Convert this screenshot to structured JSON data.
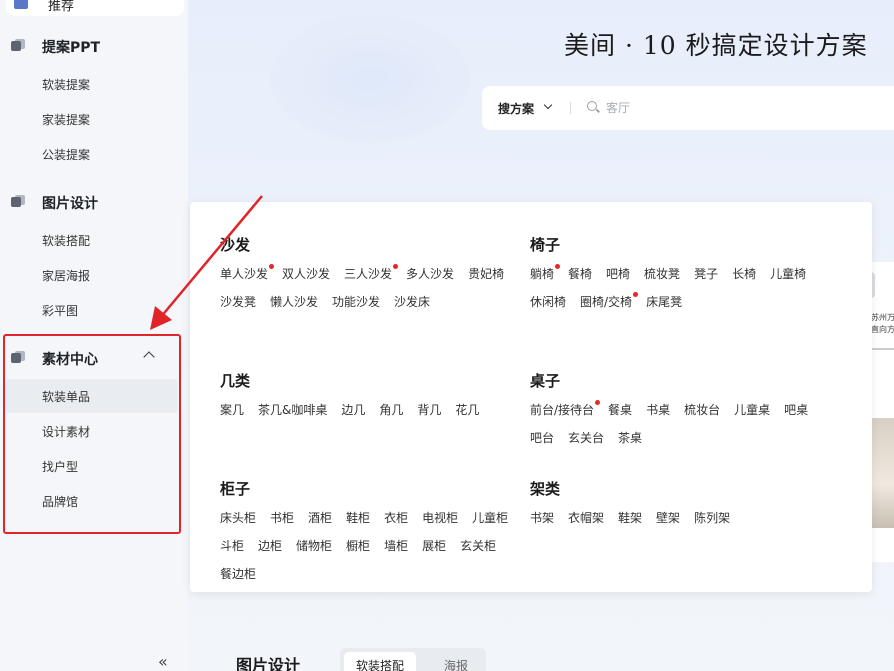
{
  "sidebar": {
    "top_item": "推荐",
    "groups": [
      {
        "label": "提案PPT",
        "items": [
          "软装提案",
          "家装提案",
          "公装提案"
        ]
      },
      {
        "label": "图片设计",
        "items": [
          "软装搭配",
          "家居海报",
          "彩平图"
        ]
      },
      {
        "label": "素材中心",
        "items": [
          "软装单品",
          "设计素材",
          "找户型",
          "品牌馆"
        ]
      }
    ],
    "collapse_glyph": "«"
  },
  "hero": {
    "title": "美间 · 10 秒搞定设计方案"
  },
  "search": {
    "scope_label": "搜方案",
    "placeholder": "客厅"
  },
  "side_card": {
    "line1": "苏州万",
    "line2": "直向方"
  },
  "panel": {
    "categories": [
      {
        "title": "沙发",
        "items": [
          {
            "label": "单人沙发",
            "hot": true
          },
          {
            "label": "双人沙发",
            "hot": false
          },
          {
            "label": "三人沙发",
            "hot": true
          },
          {
            "label": "多人沙发",
            "hot": false
          },
          {
            "label": "贵妃椅",
            "hot": false
          },
          {
            "label": "沙发凳",
            "hot": false
          },
          {
            "label": "懒人沙发",
            "hot": false
          },
          {
            "label": "功能沙发",
            "hot": false
          },
          {
            "label": "沙发床",
            "hot": false
          }
        ]
      },
      {
        "title": "椅子",
        "items": [
          {
            "label": "躺椅",
            "hot": true
          },
          {
            "label": "餐椅",
            "hot": false
          },
          {
            "label": "吧椅",
            "hot": false
          },
          {
            "label": "梳妆凳",
            "hot": false
          },
          {
            "label": "凳子",
            "hot": false
          },
          {
            "label": "长椅",
            "hot": false
          },
          {
            "label": "儿童椅",
            "hot": false
          },
          {
            "label": "休闲椅",
            "hot": false
          },
          {
            "label": "圈椅/交椅",
            "hot": true
          },
          {
            "label": "床尾凳",
            "hot": false
          }
        ]
      },
      {
        "title": "几类",
        "items": [
          {
            "label": "案几",
            "hot": false
          },
          {
            "label": "茶几&咖啡桌",
            "hot": false
          },
          {
            "label": "边几",
            "hot": false
          },
          {
            "label": "角几",
            "hot": false
          },
          {
            "label": "背几",
            "hot": false
          },
          {
            "label": "花几",
            "hot": false
          }
        ]
      },
      {
        "title": "桌子",
        "items": [
          {
            "label": "前台/接待台",
            "hot": true
          },
          {
            "label": "餐桌",
            "hot": false
          },
          {
            "label": "书桌",
            "hot": false
          },
          {
            "label": "梳妆台",
            "hot": false
          },
          {
            "label": "儿童桌",
            "hot": false
          },
          {
            "label": "吧桌",
            "hot": false
          },
          {
            "label": "吧台",
            "hot": false
          },
          {
            "label": "玄关台",
            "hot": false
          },
          {
            "label": "茶桌",
            "hot": false
          }
        ]
      },
      {
        "title": "柜子",
        "items": [
          {
            "label": "床头柜",
            "hot": false
          },
          {
            "label": "书柜",
            "hot": false
          },
          {
            "label": "酒柜",
            "hot": false
          },
          {
            "label": "鞋柜",
            "hot": false
          },
          {
            "label": "衣柜",
            "hot": false
          },
          {
            "label": "电视柜",
            "hot": false
          },
          {
            "label": "儿童柜",
            "hot": false
          },
          {
            "label": "斗柜",
            "hot": false
          },
          {
            "label": "边柜",
            "hot": false
          },
          {
            "label": "储物柜",
            "hot": false
          },
          {
            "label": "橱柜",
            "hot": false
          },
          {
            "label": "墙柜",
            "hot": false
          },
          {
            "label": "展柜",
            "hot": false
          },
          {
            "label": "玄关柜",
            "hot": false
          },
          {
            "label": "餐边柜",
            "hot": false
          }
        ]
      },
      {
        "title": "架类",
        "items": [
          {
            "label": "书架",
            "hot": false
          },
          {
            "label": "衣帽架",
            "hot": false
          },
          {
            "label": "鞋架",
            "hot": false
          },
          {
            "label": "壁架",
            "hot": false
          },
          {
            "label": "陈列架",
            "hot": false
          }
        ]
      }
    ]
  },
  "bottom": {
    "title": "图片设计",
    "tabs": [
      "软装搭配",
      "海报"
    ]
  },
  "colors": {
    "annotation_red": "#e0242a",
    "hot_dot": "#e8262c"
  }
}
